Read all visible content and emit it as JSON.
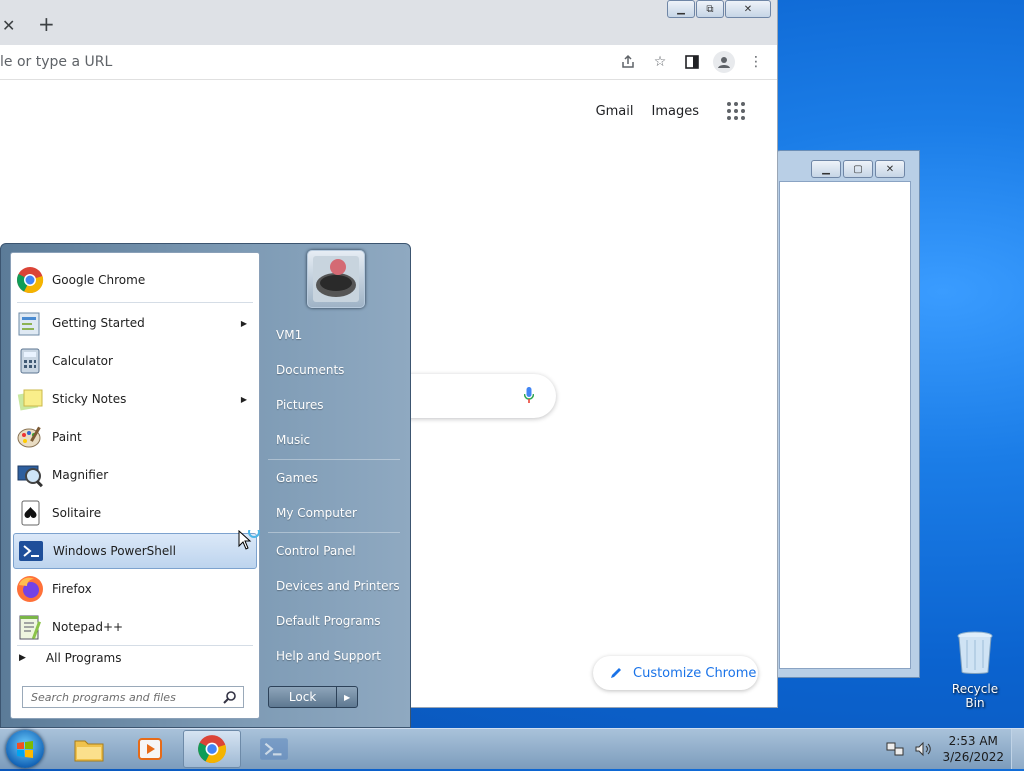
{
  "chrome": {
    "omnibox_text": "le or type a URL",
    "gmail": "Gmail",
    "images": "Images",
    "customize": "Customize Chrome",
    "window_buttons": {
      "minimize": "▭",
      "restore": "⧉",
      "close": "✕"
    }
  },
  "startmenu": {
    "programs": [
      {
        "label": "Google Chrome",
        "icon": "chrome-icon",
        "arrow": false
      },
      {
        "label": "Getting Started",
        "icon": "getting-started-icon",
        "arrow": true
      },
      {
        "label": "Calculator",
        "icon": "calculator-icon",
        "arrow": false
      },
      {
        "label": "Sticky Notes",
        "icon": "sticky-notes-icon",
        "arrow": true
      },
      {
        "label": "Paint",
        "icon": "paint-icon",
        "arrow": false
      },
      {
        "label": "Magnifier",
        "icon": "magnifier-icon",
        "arrow": false
      },
      {
        "label": "Solitaire",
        "icon": "solitaire-icon",
        "arrow": false
      },
      {
        "label": "Windows PowerShell",
        "icon": "powershell-icon",
        "arrow": false,
        "selected": true
      },
      {
        "label": "Firefox",
        "icon": "firefox-icon",
        "arrow": false
      },
      {
        "label": "Notepad++",
        "icon": "notepadpp-icon",
        "arrow": false
      }
    ],
    "all_programs": "All Programs",
    "search_placeholder": "Search programs and files",
    "right_links": [
      "VM1",
      "Documents",
      "Pictures",
      "Music",
      "Games",
      "My Computer",
      "Control Panel",
      "Devices and Printers",
      "Default Programs",
      "Help and Support"
    ],
    "lock": "Lock"
  },
  "taskbar": {
    "time": "2:53 AM",
    "date": "3/26/2022"
  },
  "desktop": {
    "recycle_bin": "Recycle Bin"
  }
}
